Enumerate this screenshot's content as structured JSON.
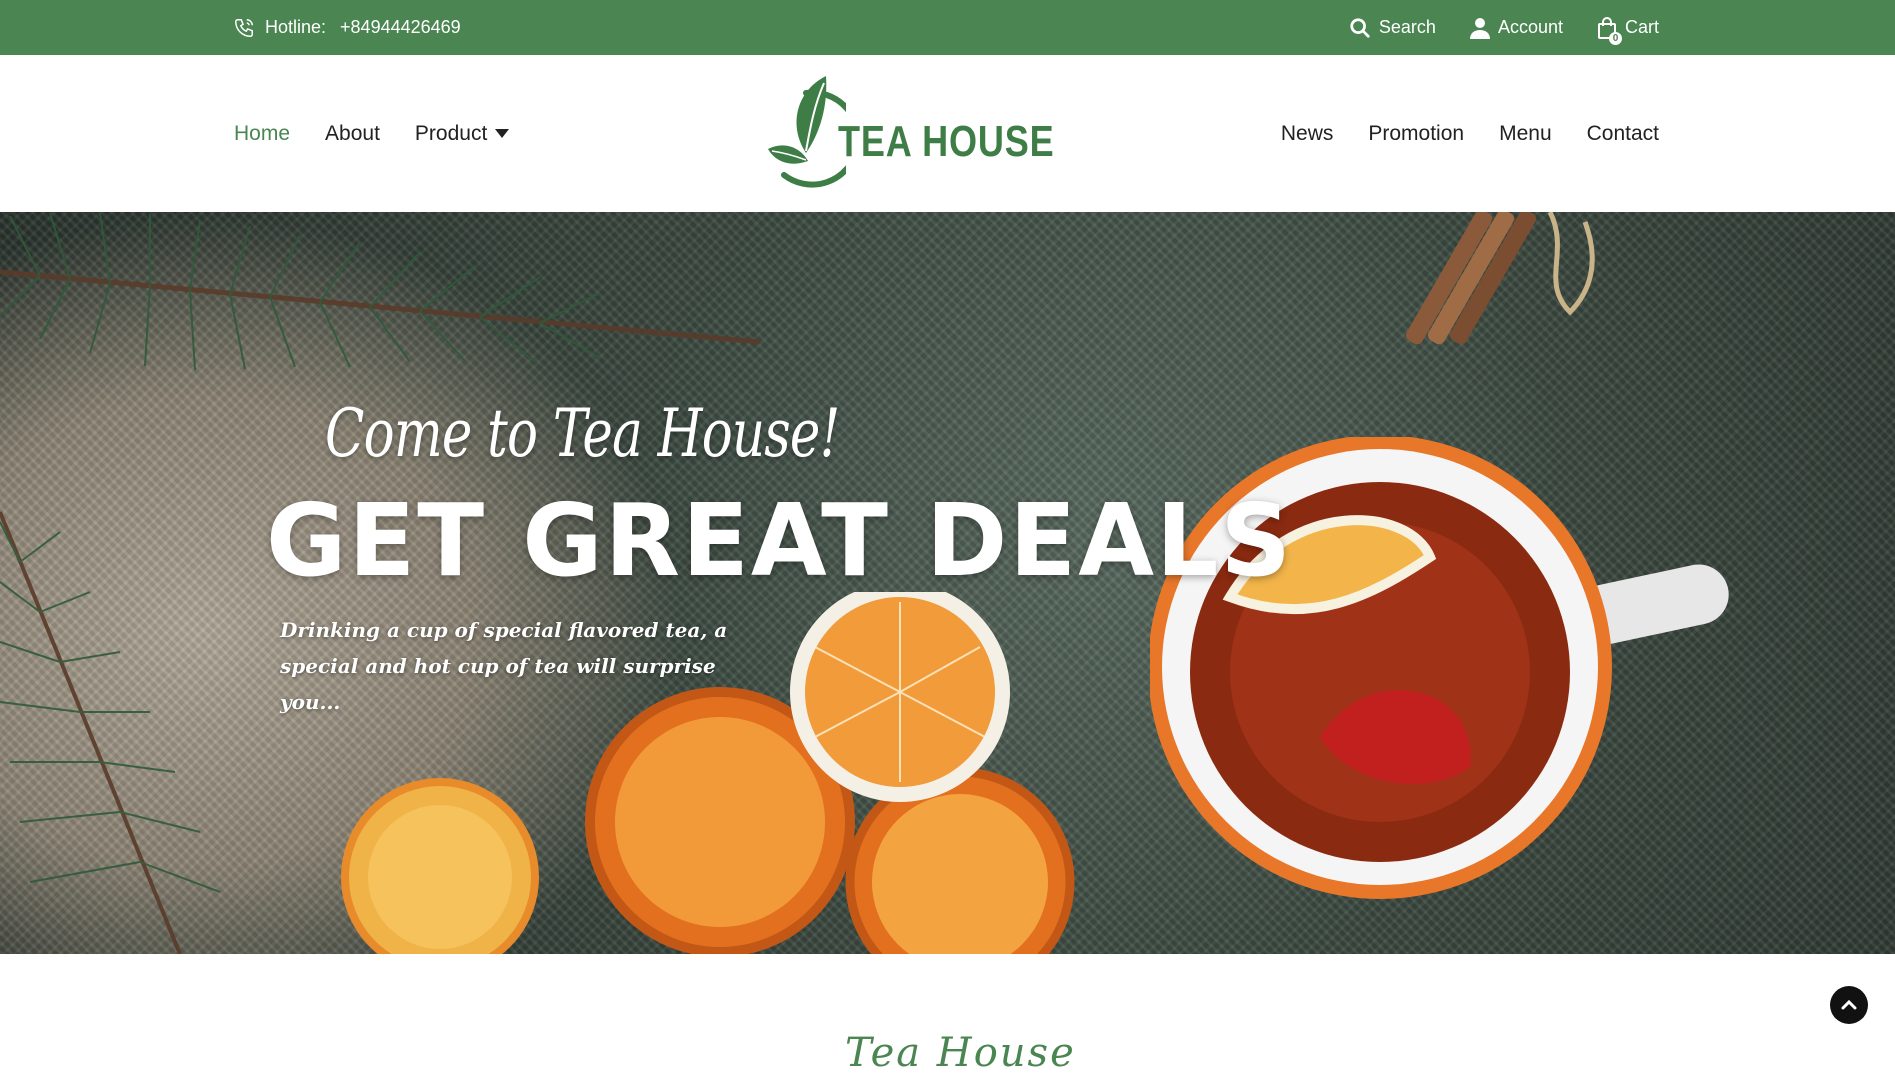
{
  "topbar": {
    "hotline_label": "Hotline:",
    "hotline_number": "+84944426469",
    "search_label": "Search",
    "account_label": "Account",
    "cart_label": "Cart",
    "cart_count": "0",
    "background_color": "#4a8552"
  },
  "nav": {
    "left": [
      {
        "label": "Home",
        "active": true
      },
      {
        "label": "About"
      },
      {
        "label": "Product",
        "has_dropdown": true
      }
    ],
    "right": [
      {
        "label": "News"
      },
      {
        "label": "Promotion"
      },
      {
        "label": "Menu"
      },
      {
        "label": "Contact"
      }
    ],
    "active_color": "#4a8552"
  },
  "logo": {
    "text": "TEA HOUSE",
    "icon": "tea-leaf-logo-icon",
    "color": "#3f7d47"
  },
  "hero": {
    "script_line": "Come to Tea House!",
    "headline": "GET GREAT DEALS",
    "description": "Drinking a cup of special flavored tea, a special and hot cup of tea will surprise you..."
  },
  "section": {
    "script_title": "Tea House"
  },
  "icons": {
    "phone": "phone-icon",
    "search": "search-icon",
    "account": "user-icon",
    "cart": "shopping-bag-icon",
    "back_to_top": "chevron-up-icon"
  }
}
